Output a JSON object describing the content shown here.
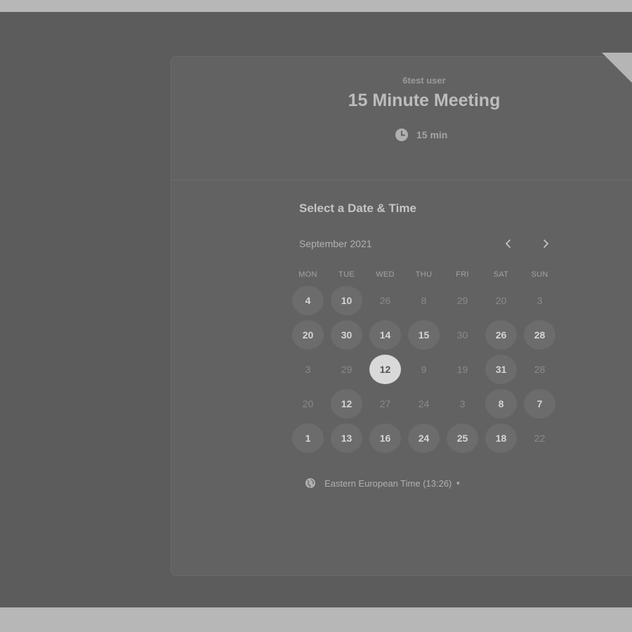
{
  "header": {
    "host_name": "6test user",
    "event_title": "15 Minute Meeting",
    "duration": "15 min"
  },
  "calendar": {
    "section_title": "Select a Date & Time",
    "month_label": "September 2021",
    "weekdays": [
      "MON",
      "TUE",
      "WED",
      "THU",
      "FRI",
      "SAT",
      "SUN"
    ],
    "days": [
      {
        "label": "4",
        "state": "available"
      },
      {
        "label": "10",
        "state": "available"
      },
      {
        "label": "26",
        "state": "unavailable"
      },
      {
        "label": "8",
        "state": "unavailable"
      },
      {
        "label": "29",
        "state": "unavailable"
      },
      {
        "label": "20",
        "state": "unavailable"
      },
      {
        "label": "3",
        "state": "unavailable"
      },
      {
        "label": "20",
        "state": "available"
      },
      {
        "label": "30",
        "state": "available"
      },
      {
        "label": "14",
        "state": "available"
      },
      {
        "label": "15",
        "state": "available"
      },
      {
        "label": "30",
        "state": "unavailable"
      },
      {
        "label": "26",
        "state": "available"
      },
      {
        "label": "28",
        "state": "available"
      },
      {
        "label": "3",
        "state": "unavailable"
      },
      {
        "label": "29",
        "state": "unavailable"
      },
      {
        "label": "12",
        "state": "selected"
      },
      {
        "label": "9",
        "state": "unavailable"
      },
      {
        "label": "19",
        "state": "unavailable"
      },
      {
        "label": "31",
        "state": "available"
      },
      {
        "label": "28",
        "state": "unavailable"
      },
      {
        "label": "20",
        "state": "unavailable"
      },
      {
        "label": "12",
        "state": "available"
      },
      {
        "label": "27",
        "state": "unavailable"
      },
      {
        "label": "24",
        "state": "unavailable"
      },
      {
        "label": "3",
        "state": "unavailable"
      },
      {
        "label": "8",
        "state": "available"
      },
      {
        "label": "7",
        "state": "available"
      },
      {
        "label": "1",
        "state": "available"
      },
      {
        "label": "13",
        "state": "available"
      },
      {
        "label": "16",
        "state": "available"
      },
      {
        "label": "24",
        "state": "available"
      },
      {
        "label": "25",
        "state": "available"
      },
      {
        "label": "18",
        "state": "available"
      },
      {
        "label": "22",
        "state": "unavailable"
      }
    ]
  },
  "timezone": {
    "label": "Eastern European Time (13:26)"
  },
  "icons": {
    "clock": "clock-icon",
    "globe": "globe-icon",
    "prev": "chevron-left-icon",
    "next": "chevron-right-icon",
    "caret": "caret-down-icon"
  }
}
